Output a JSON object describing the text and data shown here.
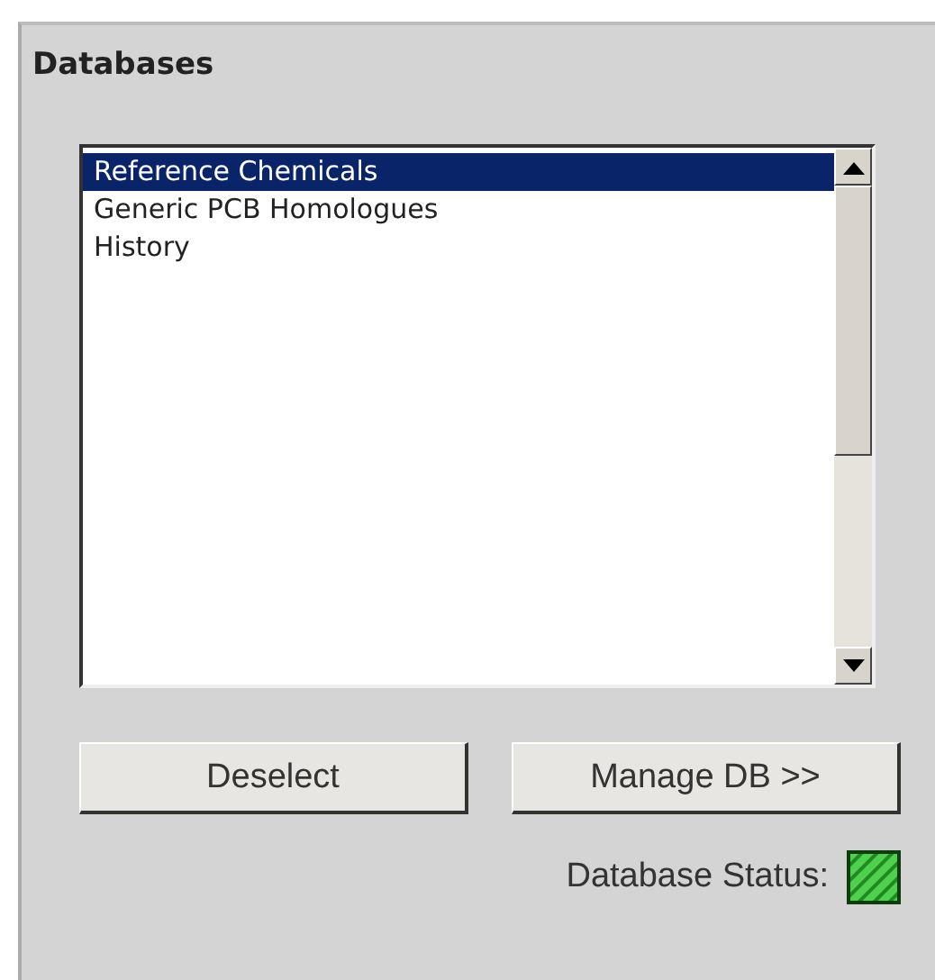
{
  "panel": {
    "title": "Databases"
  },
  "databases": [
    {
      "label": "Reference Chemicals",
      "selected": true
    },
    {
      "label": "Generic PCB Homologues",
      "selected": false
    },
    {
      "label": "History",
      "selected": false
    }
  ],
  "buttons": [
    "Deselect",
    "Manage DB >>"
  ],
  "status": {
    "label": "Database Status:",
    "ok": true
  }
}
